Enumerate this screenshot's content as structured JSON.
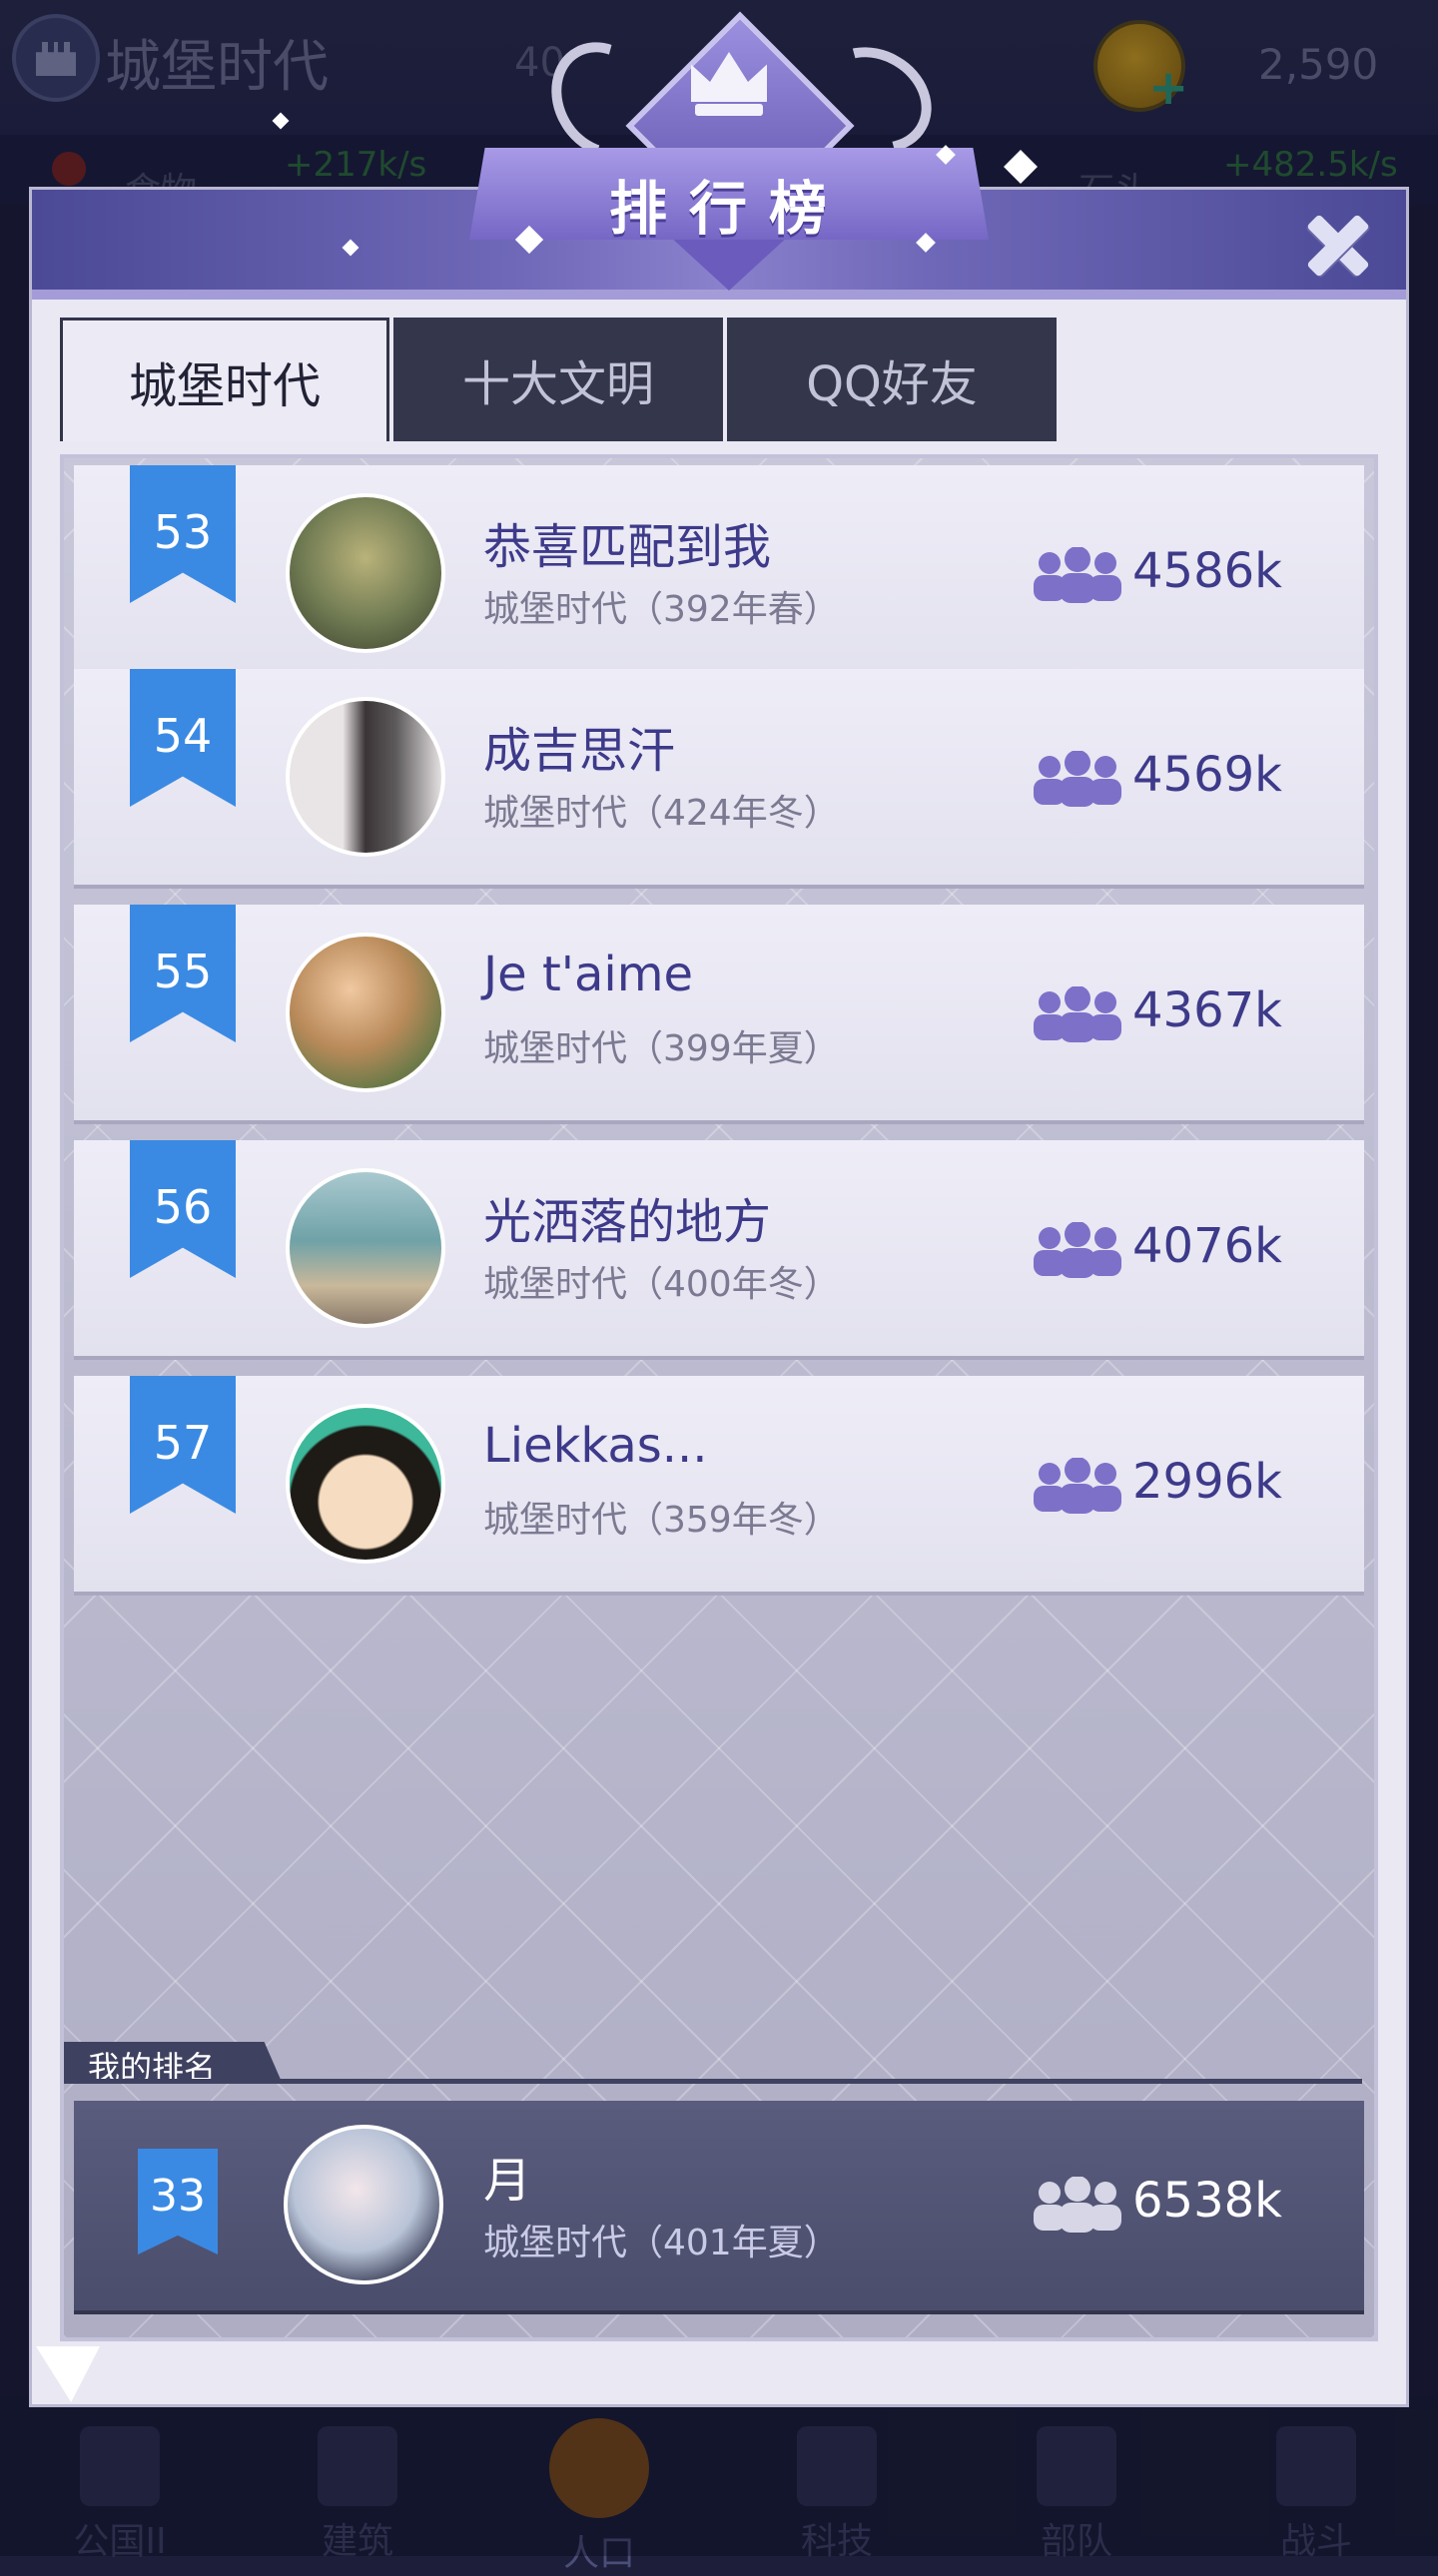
{
  "background": {
    "game_title": "城堡时代",
    "population_partial": "40",
    "coins": "2,590",
    "resources": [
      {
        "label": "食物",
        "rate": "+217k/s"
      },
      {
        "label": "石头",
        "rate": "+482.5k/s"
      }
    ],
    "nav": [
      {
        "label": "公国II",
        "icon": "castle-icon"
      },
      {
        "label": "建筑",
        "icon": "house-icon"
      },
      {
        "label": "人口",
        "icon": "person-icon",
        "active": true
      },
      {
        "label": "科技",
        "icon": "book-icon"
      },
      {
        "label": "部队",
        "icon": "banner-icon"
      },
      {
        "label": "战斗",
        "icon": "swords-icon"
      }
    ]
  },
  "modal": {
    "title": "排行榜",
    "close_icon": "close-icon",
    "tabs": [
      {
        "label": "城堡时代",
        "active": true
      },
      {
        "label": "十大文明",
        "active": false
      },
      {
        "label": "QQ好友",
        "active": false
      }
    ],
    "rankings": [
      {
        "rank": "53",
        "name": "恭喜匹配到我",
        "era": "城堡时代（392年春）",
        "population": "4586k",
        "avatar_color": "#6f7a52"
      },
      {
        "rank": "54",
        "name": "成吉思汗",
        "era": "城堡时代（424年冬）",
        "population": "4569k",
        "avatar_color": "#5d5a5c"
      },
      {
        "rank": "55",
        "name": "Je t'aime",
        "era": "城堡时代（399年夏）",
        "population": "4367k",
        "avatar_color": "#b98a5a"
      },
      {
        "rank": "56",
        "name": "光洒落的地方",
        "era": "城堡时代（400年冬）",
        "population": "4076k",
        "avatar_color": "#6fa2a8"
      },
      {
        "rank": "57",
        "name": "Liekkas...",
        "era": "城堡时代（359年冬）",
        "population": "2996k",
        "avatar_color": "#3db89a"
      }
    ],
    "my_rank": {
      "label": "我的排名",
      "rank": "33",
      "name": "月",
      "era": "城堡时代（401年夏）",
      "population": "6538k",
      "avatar_color": "#b9c4d8"
    }
  },
  "colors": {
    "accent_purple": "#3e3a8a",
    "rank_blue": "#3a8ae4",
    "header_purple": "#6f68b8"
  }
}
